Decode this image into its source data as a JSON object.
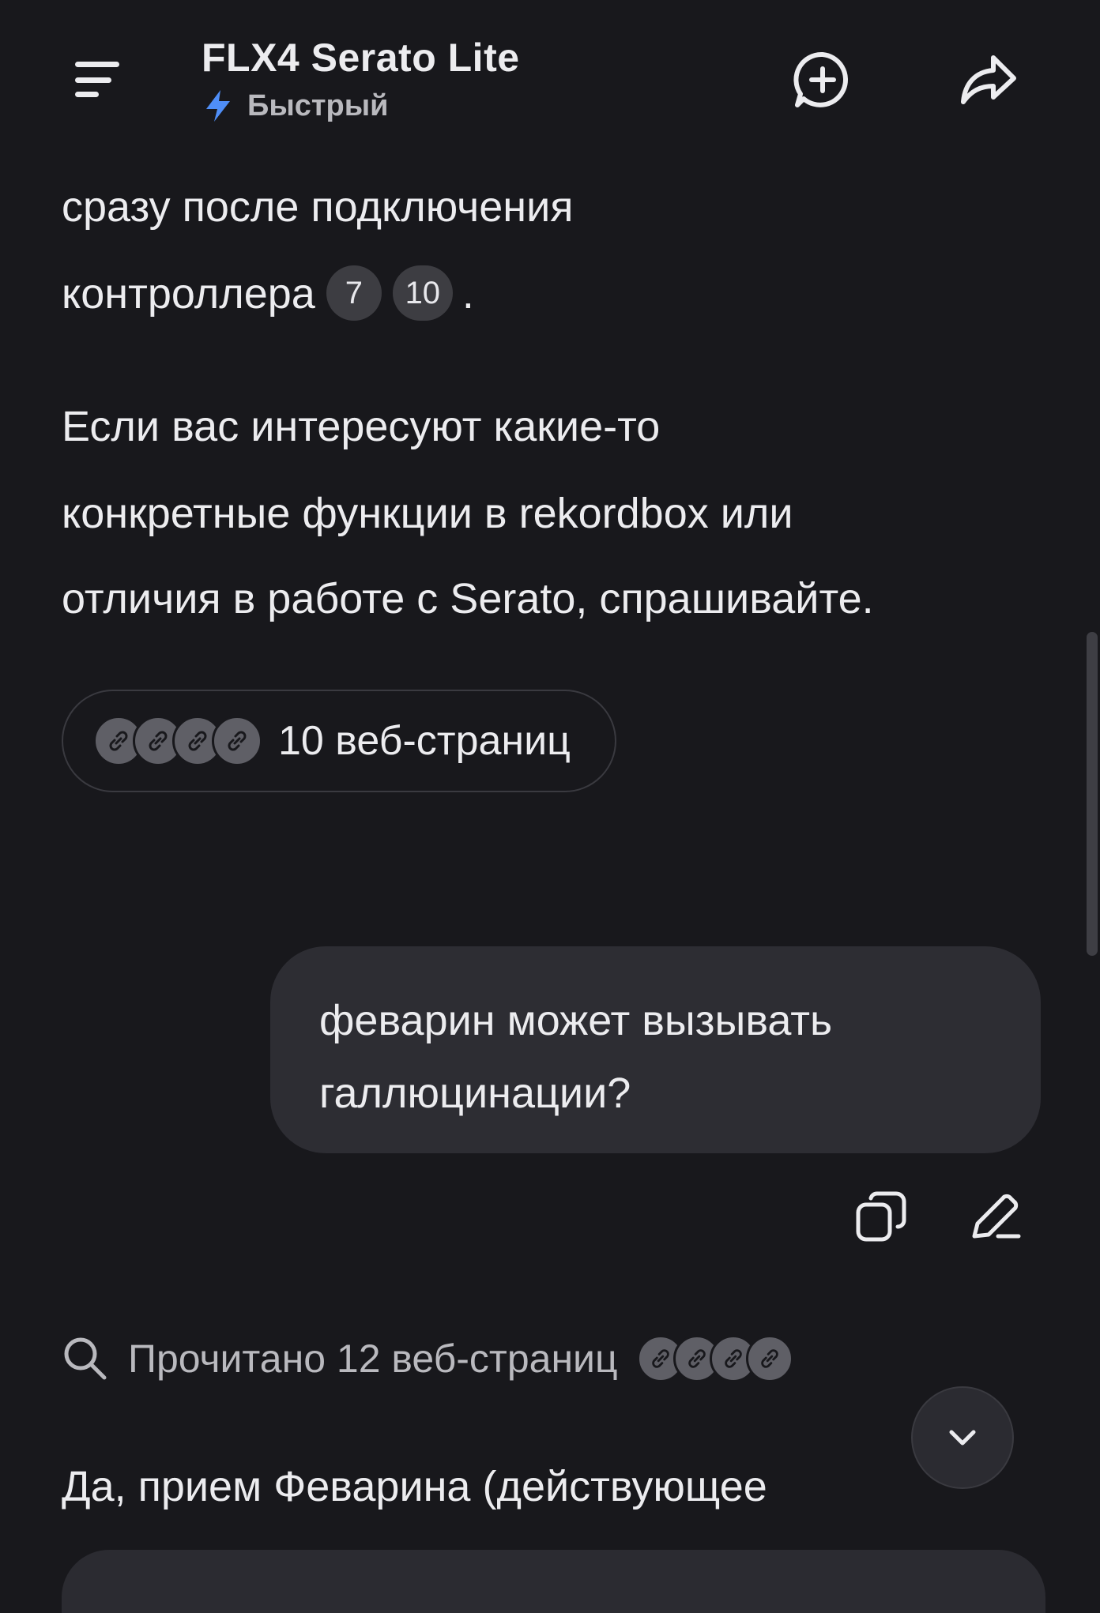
{
  "header": {
    "title": "FLX4 Serato Lite",
    "mode_label": "Быстрый",
    "accent_color": "#4f8ef7"
  },
  "assistant_message": {
    "line1": "сразу после подключения",
    "line2": "контроллера",
    "refs": [
      "7",
      "10"
    ],
    "line2_end": ".",
    "paragraph2": [
      "Если вас интересуют какие-то",
      "конкретные функции в rekordbox или",
      "отличия в работе с Serato, спрашивайте."
    ],
    "sources_label": "10 веб-страниц"
  },
  "user_message": {
    "lines": [
      "феварин может вызывать",
      "галлюцинации?"
    ]
  },
  "read_status": "Прочитано 12 веб-страниц",
  "answer_start": "Да, прием Феварина (действующее",
  "icons": {
    "menu": "menu-icon",
    "new_chat": "add-chat-icon",
    "share": "share-icon",
    "copy": "copy-icon",
    "edit": "edit-icon",
    "search": "search-icon",
    "link": "link-icon",
    "scroll_down": "chevron-down-icon",
    "mode": "lightning-icon"
  }
}
